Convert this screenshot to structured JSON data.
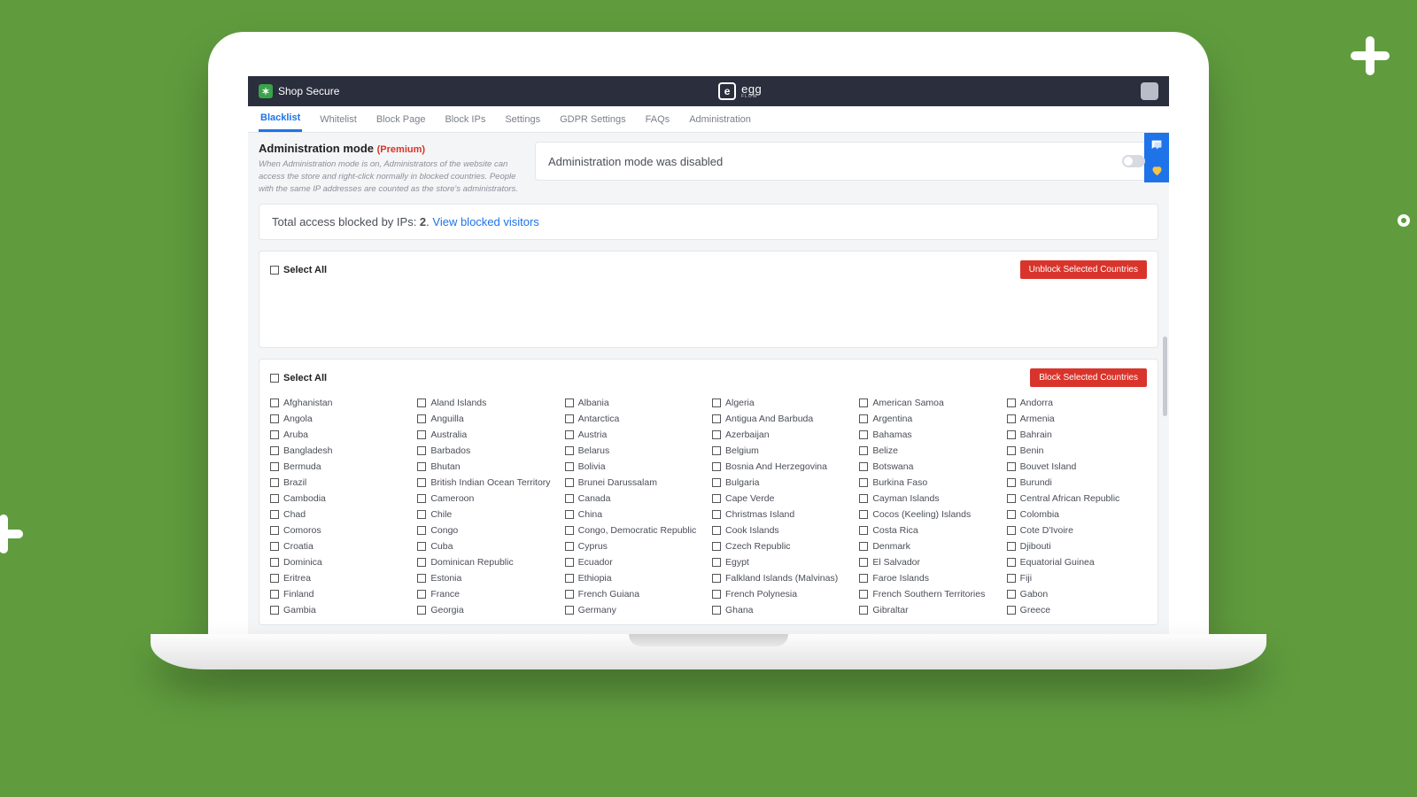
{
  "topbar": {
    "app_name": "Shop Secure",
    "logo_main": "egg",
    "logo_sub": "FLOW"
  },
  "tabs": {
    "items": [
      "Blacklist",
      "Whitelist",
      "Block Page",
      "Block IPs",
      "Settings",
      "GDPR Settings",
      "FAQs",
      "Administration"
    ],
    "active_index": 0
  },
  "admin": {
    "title": "Administration mode",
    "premium_tag": "(Premium)",
    "description": "When Administration mode is on, Administrators of the website can access the store and right-click normally in blocked countries. People with the same IP addresses are counted as the store's administrators.",
    "card_text": "Administration mode was disabled"
  },
  "stats": {
    "prefix": "Total access blocked by IPs: ",
    "count": "2",
    "suffix": ". ",
    "link": "View blocked visitors"
  },
  "panel_unblock": {
    "select_all": "Select All",
    "button": "Unblock Selected Countries"
  },
  "panel_block": {
    "select_all": "Select All",
    "button": "Block Selected Countries"
  },
  "countries": [
    "Afghanistan",
    "Aland Islands",
    "Albania",
    "Algeria",
    "American Samoa",
    "Andorra",
    "Angola",
    "Anguilla",
    "Antarctica",
    "Antigua And Barbuda",
    "Argentina",
    "Armenia",
    "Aruba",
    "Australia",
    "Austria",
    "Azerbaijan",
    "Bahamas",
    "Bahrain",
    "Bangladesh",
    "Barbados",
    "Belarus",
    "Belgium",
    "Belize",
    "Benin",
    "Bermuda",
    "Bhutan",
    "Bolivia",
    "Bosnia And Herzegovina",
    "Botswana",
    "Bouvet Island",
    "Brazil",
    "British Indian Ocean Territory",
    "Brunei Darussalam",
    "Bulgaria",
    "Burkina Faso",
    "Burundi",
    "Cambodia",
    "Cameroon",
    "Canada",
    "Cape Verde",
    "Cayman Islands",
    "Central African Republic",
    "Chad",
    "Chile",
    "China",
    "Christmas Island",
    "Cocos (Keeling) Islands",
    "Colombia",
    "Comoros",
    "Congo",
    "Congo, Democratic Republic",
    "Cook Islands",
    "Costa Rica",
    "Cote D'Ivoire",
    "Croatia",
    "Cuba",
    "Cyprus",
    "Czech Republic",
    "Denmark",
    "Djibouti",
    "Dominica",
    "Dominican Republic",
    "Ecuador",
    "Egypt",
    "El Salvador",
    "Equatorial Guinea",
    "Eritrea",
    "Estonia",
    "Ethiopia",
    "Falkland Islands (Malvinas)",
    "Faroe Islands",
    "Fiji",
    "Finland",
    "France",
    "French Guiana",
    "French Polynesia",
    "French Southern Territories",
    "Gabon",
    "Gambia",
    "Georgia",
    "Germany",
    "Ghana",
    "Gibraltar",
    "Greece"
  ]
}
